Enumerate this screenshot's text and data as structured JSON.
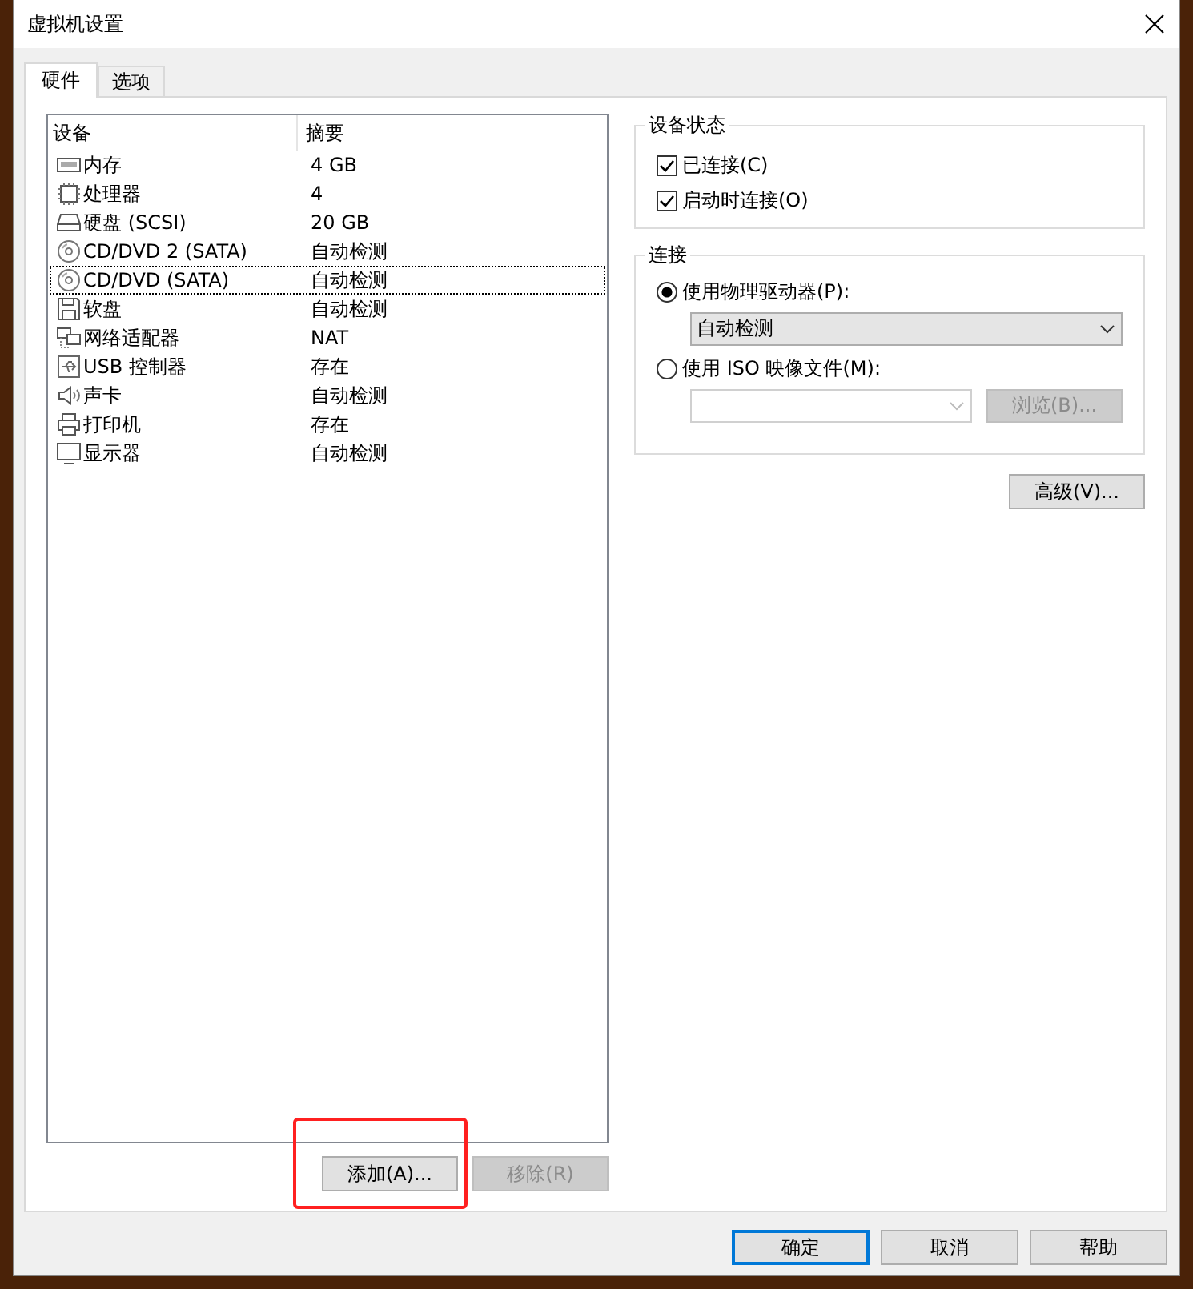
{
  "window": {
    "title": "虚拟机设置"
  },
  "tabs": [
    {
      "label": "硬件",
      "selected": true
    },
    {
      "label": "选项",
      "selected": false
    }
  ],
  "devices": {
    "columns": [
      "设备",
      "摘要"
    ],
    "rows": [
      {
        "kind": "memory",
        "name": "内存",
        "summary": "4 GB",
        "selected": false
      },
      {
        "kind": "cpu",
        "name": "处理器",
        "summary": "4",
        "selected": false
      },
      {
        "kind": "disk",
        "name": "硬盘 (SCSI)",
        "summary": "20 GB",
        "selected": false
      },
      {
        "kind": "cd",
        "name": "CD/DVD 2 (SATA)",
        "summary": "自动检测",
        "selected": false
      },
      {
        "kind": "cd",
        "name": "CD/DVD (SATA)",
        "summary": "自动检测",
        "selected": true
      },
      {
        "kind": "floppy",
        "name": "软盘",
        "summary": "自动检测",
        "selected": false
      },
      {
        "kind": "network",
        "name": "网络适配器",
        "summary": "NAT",
        "selected": false
      },
      {
        "kind": "usb",
        "name": "USB 控制器",
        "summary": "存在",
        "selected": false
      },
      {
        "kind": "sound",
        "name": "声卡",
        "summary": "自动检测",
        "selected": false
      },
      {
        "kind": "printer",
        "name": "打印机",
        "summary": "存在",
        "selected": false
      },
      {
        "kind": "display",
        "name": "显示器",
        "summary": "自动检测",
        "selected": false
      }
    ]
  },
  "list_buttons": [
    {
      "label": "添加(A)...",
      "disabled": false,
      "highlighted": true
    },
    {
      "label": "移除(R)",
      "disabled": true,
      "highlighted": false
    }
  ],
  "device_status": {
    "title": "设备状态",
    "options": [
      {
        "label": "已连接(C)",
        "checked": true
      },
      {
        "label": "启动时连接(O)",
        "checked": true
      }
    ]
  },
  "connection": {
    "title": "连接",
    "options": [
      {
        "kind": "physical",
        "label": "使用物理驱动器(P):",
        "selected": true,
        "dropdown": {
          "value": "自动检测",
          "disabled": false
        }
      },
      {
        "kind": "iso",
        "label": "使用 ISO 映像文件(M):",
        "selected": false,
        "dropdown": {
          "disabled": true
        },
        "browse": {
          "label": "浏览(B)...",
          "disabled": true
        }
      }
    ]
  },
  "advanced_button": {
    "label": "高级(V)...",
    "disabled": false
  },
  "footer_buttons": [
    {
      "label": "确定",
      "default": true
    },
    {
      "label": "取消",
      "default": false
    },
    {
      "label": "帮助",
      "default": false
    }
  ]
}
